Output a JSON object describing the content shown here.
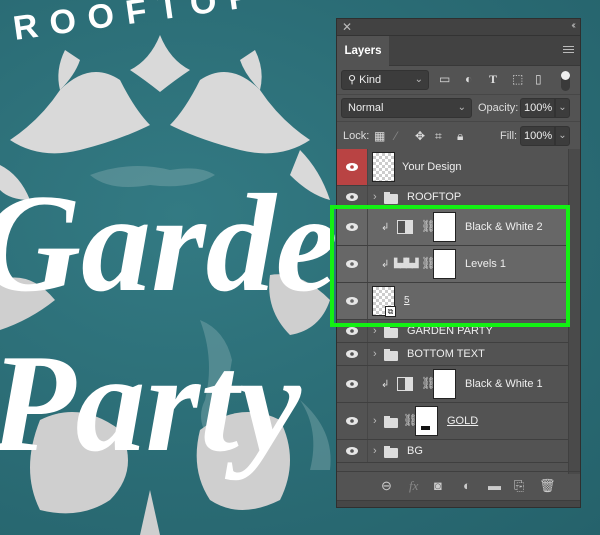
{
  "canvas": {
    "top_text": "ROOFTOP",
    "script_line_1": "Garden",
    "script_line_2": "Party",
    "background_color": "#2c6f78"
  },
  "panel": {
    "tab_label": "Layers",
    "filter": {
      "kind_label": "Kind"
    },
    "blend_mode": "Normal",
    "opacity_label": "Opacity:",
    "opacity_value": "100%",
    "lock_label": "Lock:",
    "fill_label": "Fill:",
    "fill_value": "100%",
    "layers": [
      {
        "name": "Your Design",
        "type": "pixel",
        "visible": true,
        "highlighted": true
      },
      {
        "name": "ROOFTOP",
        "type": "group",
        "visible": true
      },
      {
        "name": "Black & White 2",
        "type": "adjustment-bw",
        "clipped": true,
        "visible": true,
        "selected": true
      },
      {
        "name": "Levels 1",
        "type": "adjustment-levels",
        "clipped": true,
        "visible": true,
        "selected": true
      },
      {
        "name": "5",
        "type": "smart-object",
        "visible": true,
        "selected": true
      },
      {
        "name": "GARDEN PARTY",
        "type": "group",
        "visible": true
      },
      {
        "name": "BOTTOM TEXT",
        "type": "group",
        "visible": true
      },
      {
        "name": "Black & White 1",
        "type": "adjustment-bw",
        "clipped": true,
        "visible": true
      },
      {
        "name": "GOLD",
        "type": "group-masked",
        "visible": true
      },
      {
        "name": "BG",
        "type": "group",
        "visible": true
      }
    ],
    "highlight_color": "#13f113",
    "footer_icons": [
      "link-icon",
      "fx-icon",
      "mask-icon",
      "adjustment-icon",
      "new-group-icon",
      "new-layer-icon",
      "trash-icon"
    ]
  }
}
